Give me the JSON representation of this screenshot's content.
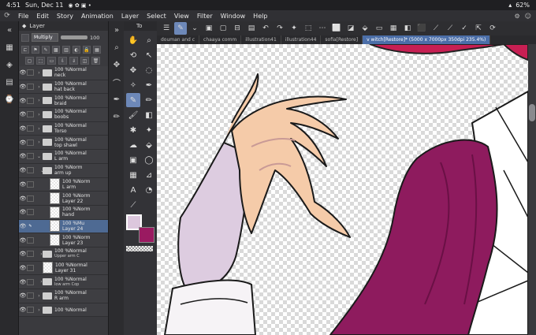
{
  "status": {
    "time": "4:51",
    "date": "Sun, Dec 11",
    "battery": "62%"
  },
  "menu": [
    "File",
    "Edit",
    "Story",
    "Animation",
    "Layer",
    "Select",
    "View",
    "Filter",
    "Window",
    "Help"
  ],
  "layer_panel": {
    "title": "Layer",
    "blend_mode": "Multiply",
    "opacity": "100",
    "layers": [
      {
        "l1": "100 %Normal",
        "l2": "neck",
        "kind": "folder"
      },
      {
        "l1": "100 %Normal",
        "l2": "hat back",
        "kind": "folder"
      },
      {
        "l1": "100 %Normal",
        "l2": "braid",
        "kind": "folder"
      },
      {
        "l1": "100 %Normal",
        "l2": "boobs",
        "kind": "folder"
      },
      {
        "l1": "100 %Normal",
        "l2": "Torso",
        "kind": "folder"
      },
      {
        "l1": "100 %Normal",
        "l2": "top shawl",
        "kind": "folder"
      },
      {
        "l1": "100 %Normal",
        "l2": "L arm",
        "kind": "folder"
      },
      {
        "l1": "100 %Norm",
        "l2": "arm up",
        "kind": "folder"
      },
      {
        "l1": "100 %Norm",
        "l2": "L arm",
        "kind": "raster"
      },
      {
        "l1": "100 %Norm",
        "l2": "Layer 22",
        "kind": "raster"
      },
      {
        "l1": "100 %Norm",
        "l2": "hand",
        "kind": "raster"
      },
      {
        "l1": "100 %Mu",
        "l2": "Layer 24",
        "kind": "raster",
        "selected": true
      },
      {
        "l1": "100 %Norm",
        "l2": "Layer 23",
        "kind": "raster"
      },
      {
        "l1": "100 %Normal",
        "l2": "Upper arm C",
        "kind": "folder"
      },
      {
        "l1": "100 %Normal",
        "l2": "Layer 31",
        "kind": "raster"
      },
      {
        "l1": "100 %Normal",
        "l2": "low arm Cop",
        "kind": "folder"
      },
      {
        "l1": "100 %Normal",
        "l2": "R arm",
        "kind": "folder"
      },
      {
        "l1": "100 %Normal",
        "l2": "",
        "kind": "folder"
      }
    ]
  },
  "tool_panel": {
    "title": "To"
  },
  "tabs": [
    "douman and c",
    "chaaya comm",
    "illustration41",
    "illustration44",
    "sofia[Restore]",
    "v witch[Restore]* (5000 x 7000px 350dpi 235.4%)"
  ],
  "colors": {
    "main": "#dcc7dd",
    "sub": "#9a1a61",
    "selected_layer": "#4e6a93",
    "accent": "#6d88b8"
  }
}
